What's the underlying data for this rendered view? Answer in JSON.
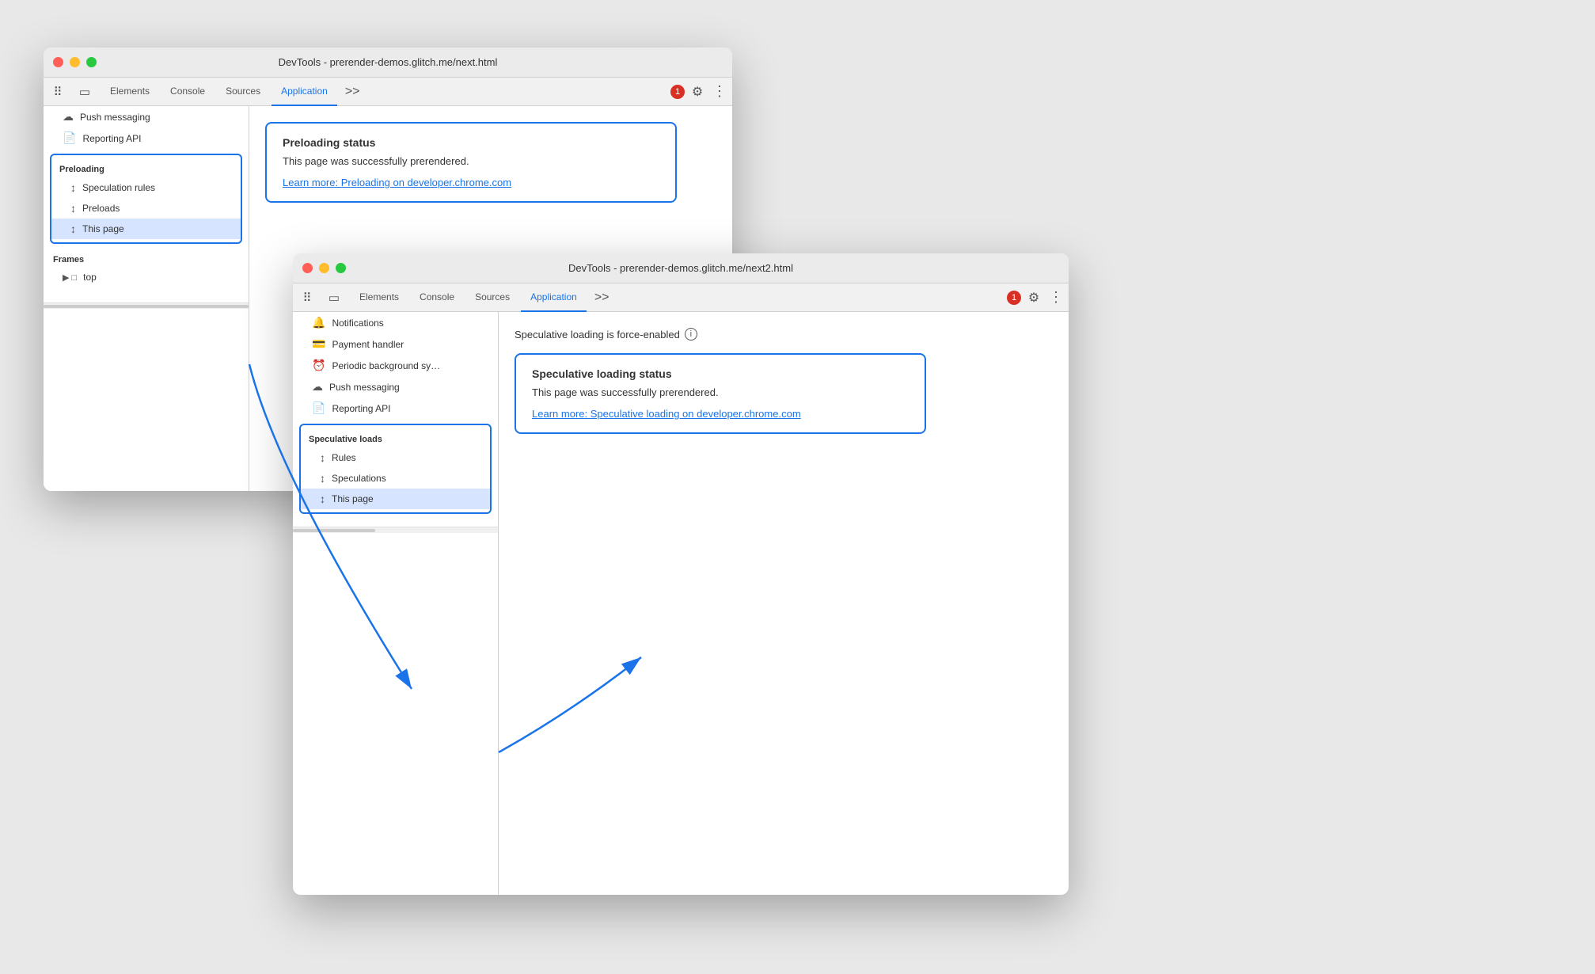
{
  "window1": {
    "title": "DevTools - prerender-demos.glitch.me/next.html",
    "tabs": {
      "icons": [
        "inspector",
        "device-toolbar"
      ],
      "items": [
        "Elements",
        "Console",
        "Sources",
        "Application"
      ],
      "active": "Application",
      "more": ">>",
      "error_count": "1",
      "settings_icon": "⚙",
      "kebab_icon": "⋮"
    },
    "sidebar": {
      "items_top": [
        {
          "icon": "☁",
          "label": "Push messaging"
        },
        {
          "icon": "📄",
          "label": "Reporting API"
        }
      ],
      "preloading_section": {
        "title": "Preloading",
        "items": [
          {
            "icon": "↕",
            "label": "Speculation rules"
          },
          {
            "icon": "↕",
            "label": "Preloads"
          },
          {
            "icon": "↕",
            "label": "This page",
            "active": true
          }
        ]
      },
      "frames_section": {
        "title": "Frames",
        "items": [
          {
            "icon": "▶□",
            "label": "top"
          }
        ]
      }
    },
    "main": {
      "preloading_status": {
        "title": "Preloading status",
        "text": "This page was successfully prerendered.",
        "link_text": "Learn more: Preloading on developer.chrome.com",
        "link_url": "https://developer.chrome.com"
      }
    }
  },
  "window2": {
    "title": "DevTools - prerender-demos.glitch.me/next2.html",
    "tabs": {
      "icons": [
        "inspector",
        "device-toolbar"
      ],
      "items": [
        "Elements",
        "Console",
        "Sources",
        "Application"
      ],
      "active": "Application",
      "more": ">>",
      "error_count": "1",
      "settings_icon": "⚙",
      "kebab_icon": "⋮"
    },
    "sidebar": {
      "items_top": [
        {
          "icon": "🔔",
          "label": "Notifications"
        },
        {
          "icon": "💳",
          "label": "Payment handler"
        },
        {
          "icon": "⏰",
          "label": "Periodic background sy…"
        },
        {
          "icon": "☁",
          "label": "Push messaging"
        },
        {
          "icon": "📄",
          "label": "Reporting API"
        }
      ],
      "speculative_loads_section": {
        "title": "Speculative loads",
        "items": [
          {
            "icon": "↕",
            "label": "Rules"
          },
          {
            "icon": "↕",
            "label": "Speculations"
          },
          {
            "icon": "↕",
            "label": "This page",
            "active": true
          }
        ]
      }
    },
    "main": {
      "force_enabled_notice": "Speculative loading is force-enabled",
      "speculative_loading_status": {
        "title": "Speculative loading status",
        "text": "This page was successfully prerendered.",
        "link_text": "Learn more: Speculative loading on developer.chrome.com",
        "link_url": "https://developer.chrome.com"
      }
    }
  }
}
